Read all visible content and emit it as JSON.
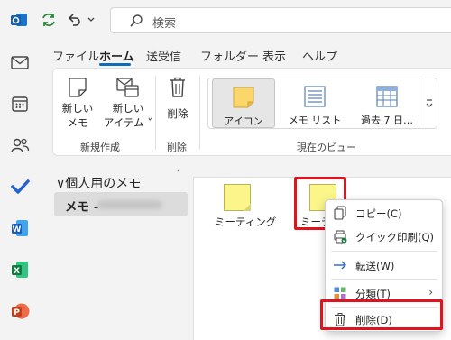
{
  "search": {
    "placeholder": "検索"
  },
  "tabs": [
    "ファイル",
    "ホーム",
    "送受信",
    "フォルダー",
    "表示",
    "ヘルプ"
  ],
  "ribbon": {
    "new_note_l1": "新しい",
    "new_note_l2": "メモ",
    "new_item_l1": "新しい",
    "new_item_l2": "アイテム ˅",
    "delete_label": "削除",
    "group_new": "新規作成",
    "group_delete": "削除",
    "group_view": "現在のビュー",
    "views": [
      "アイコン",
      "メモ リスト",
      "過去 7 日…"
    ]
  },
  "nav": {
    "collapse": "‹",
    "header": "∨個人用のメモ",
    "folder_name": "メモ -"
  },
  "notes": [
    {
      "label": "ミーティング"
    },
    {
      "label": "ミーテ"
    }
  ],
  "context_menu": {
    "items": [
      {
        "label": "コピー(C)"
      },
      {
        "label": "クイック印刷(Q)"
      },
      {
        "label": "転送(W)"
      },
      {
        "label": "分類(T)"
      },
      {
        "label": "削除(D)"
      }
    ]
  },
  "colors": {
    "accent": "#0f6cbd",
    "note_yellow": "#fbf58a",
    "highlight_red": "#e0141e"
  }
}
